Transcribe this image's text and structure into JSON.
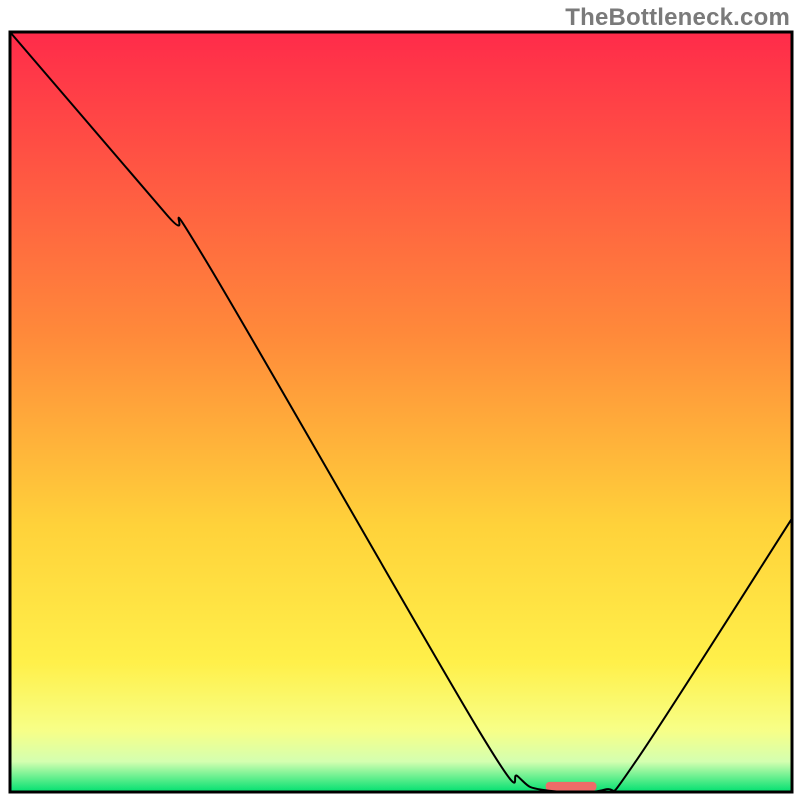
{
  "watermark": "TheBottleneck.com",
  "chart_data": {
    "type": "line",
    "title": "",
    "xlabel": "",
    "ylabel": "",
    "xlim": [
      0,
      100
    ],
    "ylim": [
      0,
      100
    ],
    "background_gradient": {
      "stops": [
        {
          "offset": 0,
          "color": "#ff2b4a"
        },
        {
          "offset": 40,
          "color": "#ff8a3a"
        },
        {
          "offset": 65,
          "color": "#ffd23a"
        },
        {
          "offset": 83,
          "color": "#fff04a"
        },
        {
          "offset": 92,
          "color": "#f7ff88"
        },
        {
          "offset": 96,
          "color": "#d4ffb0"
        },
        {
          "offset": 100,
          "color": "#00e070"
        }
      ]
    },
    "red_bar": {
      "x_start": 68.5,
      "x_end": 75,
      "color": "#ef6b68",
      "thickness_pct": 1.2
    },
    "series": [
      {
        "name": "curve",
        "stroke": "#000000",
        "stroke_width": 2,
        "points": [
          {
            "x": 0,
            "y": 100
          },
          {
            "x": 20,
            "y": 76
          },
          {
            "x": 25,
            "y": 70
          },
          {
            "x": 60,
            "y": 8
          },
          {
            "x": 65,
            "y": 2
          },
          {
            "x": 68,
            "y": 0.3
          },
          {
            "x": 76,
            "y": 0.3
          },
          {
            "x": 80,
            "y": 4
          },
          {
            "x": 100,
            "y": 36
          }
        ]
      }
    ]
  }
}
